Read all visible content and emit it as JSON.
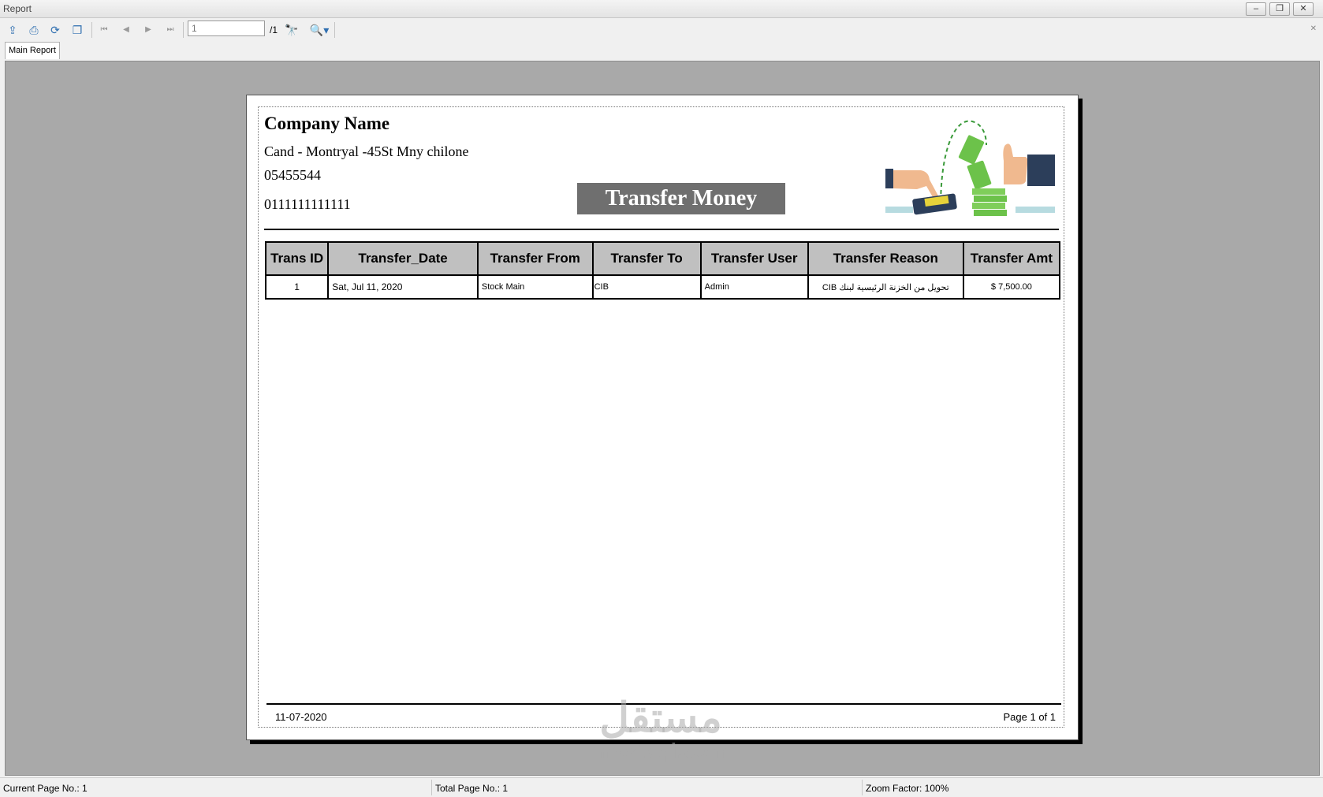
{
  "window": {
    "title": "Report",
    "buttons": {
      "minimize": "–",
      "restore": "❐",
      "close": "✕"
    }
  },
  "toolbar": {
    "page_value": "1",
    "page_total": "/1",
    "icons": [
      "export-icon",
      "print-icon",
      "refresh-icon",
      "copy-icon",
      "first-page-icon",
      "prev-page-icon",
      "next-page-icon",
      "last-page-icon",
      "search-icon",
      "zoom-icon"
    ]
  },
  "tabs": {
    "main": "Main Report"
  },
  "report": {
    "company_name": "Company Name",
    "address": "Cand - Montryal -45St Mny chilone",
    "phone1": "05455544",
    "phone2": "0111111111111",
    "title": "Transfer Money",
    "columns": [
      "Trans ID",
      "Transfer_Date",
      "Transfer From",
      "Transfer To",
      "Transfer User",
      "Transfer Reason",
      "Transfer Amt"
    ],
    "rows": [
      {
        "id": "1",
        "date": "Sat, Jul 11, 2020",
        "from": "Stock Main",
        "to": "CIB",
        "user": "Admin",
        "reason": "تحويل من الخزنة الرئيسية لبنك CIB",
        "amount": "$ 7,500.00"
      }
    ],
    "footer_date": "11-07-2020",
    "footer_page": "Page 1 of 1"
  },
  "watermark": {
    "arabic": "مستقل",
    "latin": "mostaql.com"
  },
  "status": {
    "current_page": "Current Page No.: 1",
    "total_page": "Total Page No.: 1",
    "zoom": "Zoom Factor: 100%"
  },
  "colors": {
    "viewer_bg": "#a9a9a9",
    "title_box": "#6f6f6f",
    "header_cell": "#c0c0c0",
    "money_green": "#6cc24a"
  }
}
